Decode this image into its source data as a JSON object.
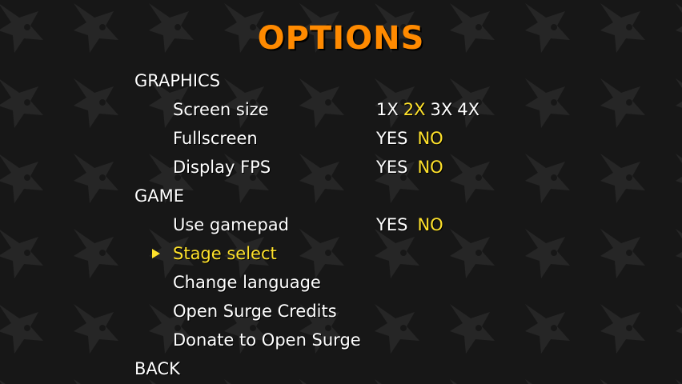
{
  "title": "OPTIONS",
  "theme": {
    "title_color": "#ff8a00",
    "text_color": "#ffffff",
    "highlight_color": "#ffe22b",
    "background_color": "#171717"
  },
  "background_icon": "surge-head-pattern-icon",
  "cursor_icon": "triangle-right-icon",
  "graphics": {
    "label": "GRAPHICS",
    "screen_size": {
      "label": "Screen size",
      "options": [
        "1X",
        "2X",
        "3X",
        "4X"
      ],
      "selected": "2X"
    },
    "fullscreen": {
      "label": "Fullscreen",
      "yes": "YES",
      "no": "NO",
      "selected": "NO"
    },
    "display_fps": {
      "label": "Display FPS",
      "yes": "YES",
      "no": "NO",
      "selected": "NO"
    }
  },
  "game": {
    "label": "GAME",
    "use_gamepad": {
      "label": "Use gamepad",
      "yes": "YES",
      "no": "NO",
      "selected": "NO"
    },
    "stage_select": {
      "label": "Stage select"
    },
    "change_language": {
      "label": "Change language"
    },
    "credits": {
      "label": "Open Surge Credits"
    },
    "donate": {
      "label": "Donate to Open Surge"
    }
  },
  "back": {
    "label": "BACK"
  },
  "highlighted_item": "Stage select"
}
